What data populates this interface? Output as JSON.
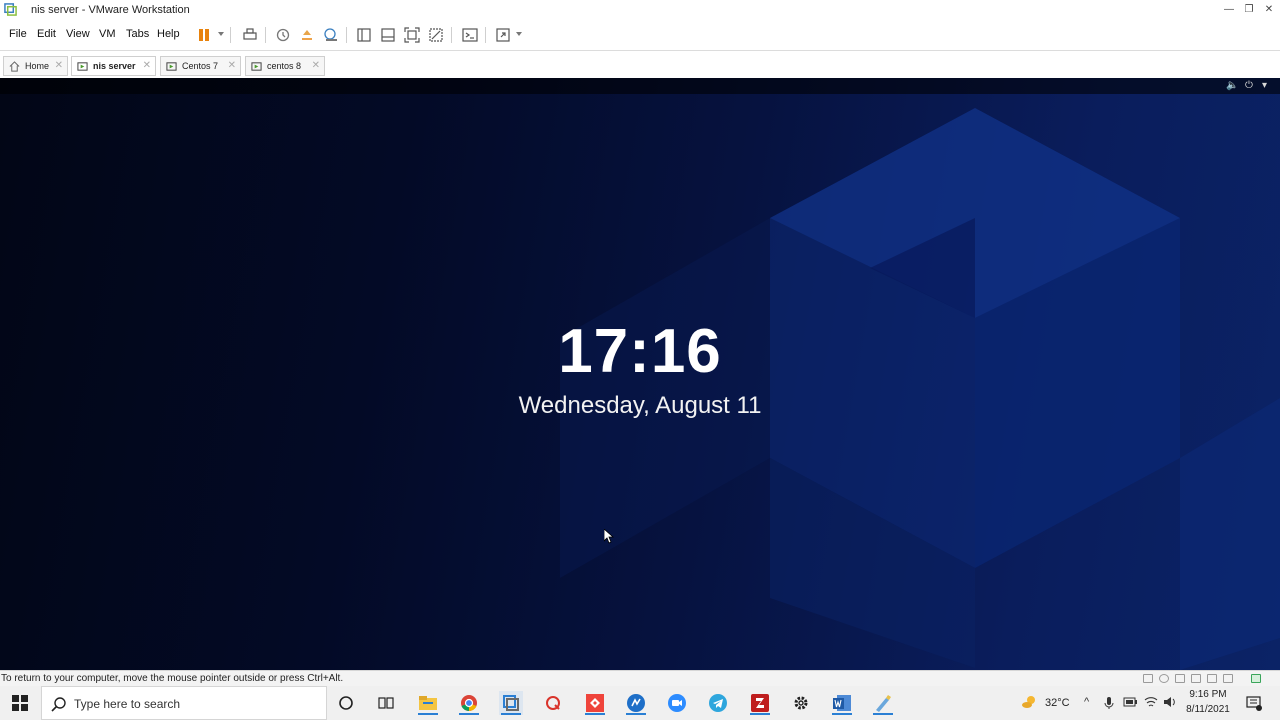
{
  "window": {
    "title": "nis server - VMware Workstation",
    "controls": {
      "minimize": "—",
      "restore": "❐",
      "close": "✕"
    }
  },
  "menu": {
    "items": [
      "File",
      "Edit",
      "View",
      "VM",
      "Tabs",
      "Help"
    ]
  },
  "toolbar": {
    "icons": [
      "pause-icon",
      "send-ctrl-alt-del-icon",
      "snapshot-icon",
      "revert-snapshot-icon",
      "snapshot-manager-icon",
      "library-icon",
      "thumbnail-bar-icon",
      "full-screen-icon",
      "unity-icon",
      "console-view-icon",
      "stretch-guest-icon"
    ],
    "accent": "#e8820c"
  },
  "tabs": [
    {
      "label": "Home",
      "icon": "home-icon",
      "active": false
    },
    {
      "label": "nis server",
      "icon": "vm-icon",
      "active": true
    },
    {
      "label": "Centos 7",
      "icon": "vm-icon",
      "active": false
    },
    {
      "label": "centos 8",
      "icon": "vm-icon",
      "active": false
    }
  ],
  "vm_screen": {
    "clock": "17:16",
    "date": "Wednesday, August 11",
    "top_bar_icons": [
      "volume-icon",
      "power-icon",
      "chevron-down-icon"
    ]
  },
  "statusbar": {
    "message": "To return to your computer, move the mouse pointer outside or press Ctrl+Alt."
  },
  "taskbar": {
    "search_placeholder": "Type here to search",
    "apps": [
      "cortana-icon",
      "task-view-icon",
      "file-explorer-icon",
      "chrome-icon",
      "vmware-icon",
      "app-red-icon",
      "anydesk-icon",
      "app-blue-icon",
      "zoom-icon",
      "telegram-icon",
      "filezilla-icon",
      "settings-icon",
      "word-icon",
      "paint-icon"
    ],
    "temperature": "32°C",
    "time": "9:16 PM",
    "date": "8/11/2021"
  }
}
